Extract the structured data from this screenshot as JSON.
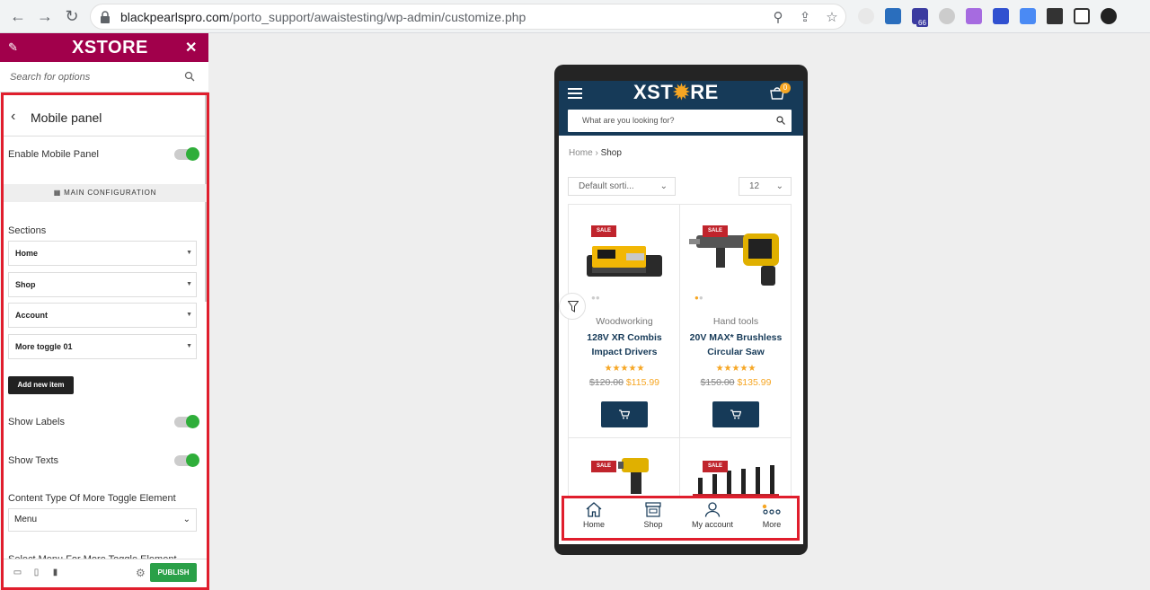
{
  "browser": {
    "url_host": "blackpearlspro.com",
    "url_path": "/porto_support/awaistesting/wp-admin/customize.php",
    "extension_badge": "66"
  },
  "sidebar": {
    "brand": "XSTORE",
    "search_placeholder": "Search for options",
    "panel_title": "Mobile panel",
    "enable_label": "Enable Mobile Panel",
    "section_header": "MAIN CONFIGURATION",
    "sections_label": "Sections",
    "sections": [
      "Home",
      "Shop",
      "Account",
      "More toggle 01"
    ],
    "add_item_label": "Add new item",
    "show_labels_label": "Show Labels",
    "show_texts_label": "Show Texts",
    "content_type_label": "Content Type Of More Toggle Element",
    "content_type_value": "Menu",
    "select_menu_label": "Select Menu For More Toggle Element",
    "publish_label": "PUBLISH",
    "toggles": {
      "enable_mobile_panel": true,
      "show_labels": true,
      "show_texts": true
    }
  },
  "phone": {
    "logo_left": "XST",
    "logo_right": "RE",
    "cart_count": "0",
    "search_placeholder": "What are you looking for?",
    "breadcrumb_home": "Home",
    "breadcrumb_current": "Shop",
    "sort_value": "Default sorti...",
    "per_page_value": "12",
    "sale_badge": "SALE",
    "products": [
      {
        "category": "Woodworking",
        "name_line1": "128V XR Combis",
        "name_line2": "Impact Drivers",
        "old_price": "$120.00",
        "new_price": "$115.99",
        "stars": "★★★★★"
      },
      {
        "category": "Hand tools",
        "name_line1": "20V MAX* Brushless",
        "name_line2": "Circular Saw",
        "old_price": "$150.00",
        "new_price": "$135.99",
        "stars": "★★★★★"
      }
    ],
    "mobile_panel": [
      {
        "label": "Home",
        "icon": "home-icon"
      },
      {
        "label": "Shop",
        "icon": "shop-icon"
      },
      {
        "label": "My account",
        "icon": "user-icon"
      },
      {
        "label": "More",
        "icon": "more-icon"
      }
    ]
  },
  "colors": {
    "brand": "#a1004b",
    "header": "#163a58",
    "accent": "#f6a623",
    "highlight": "#e01e2d",
    "toggle_on": "#2fae3a",
    "publish": "#2aa048"
  }
}
